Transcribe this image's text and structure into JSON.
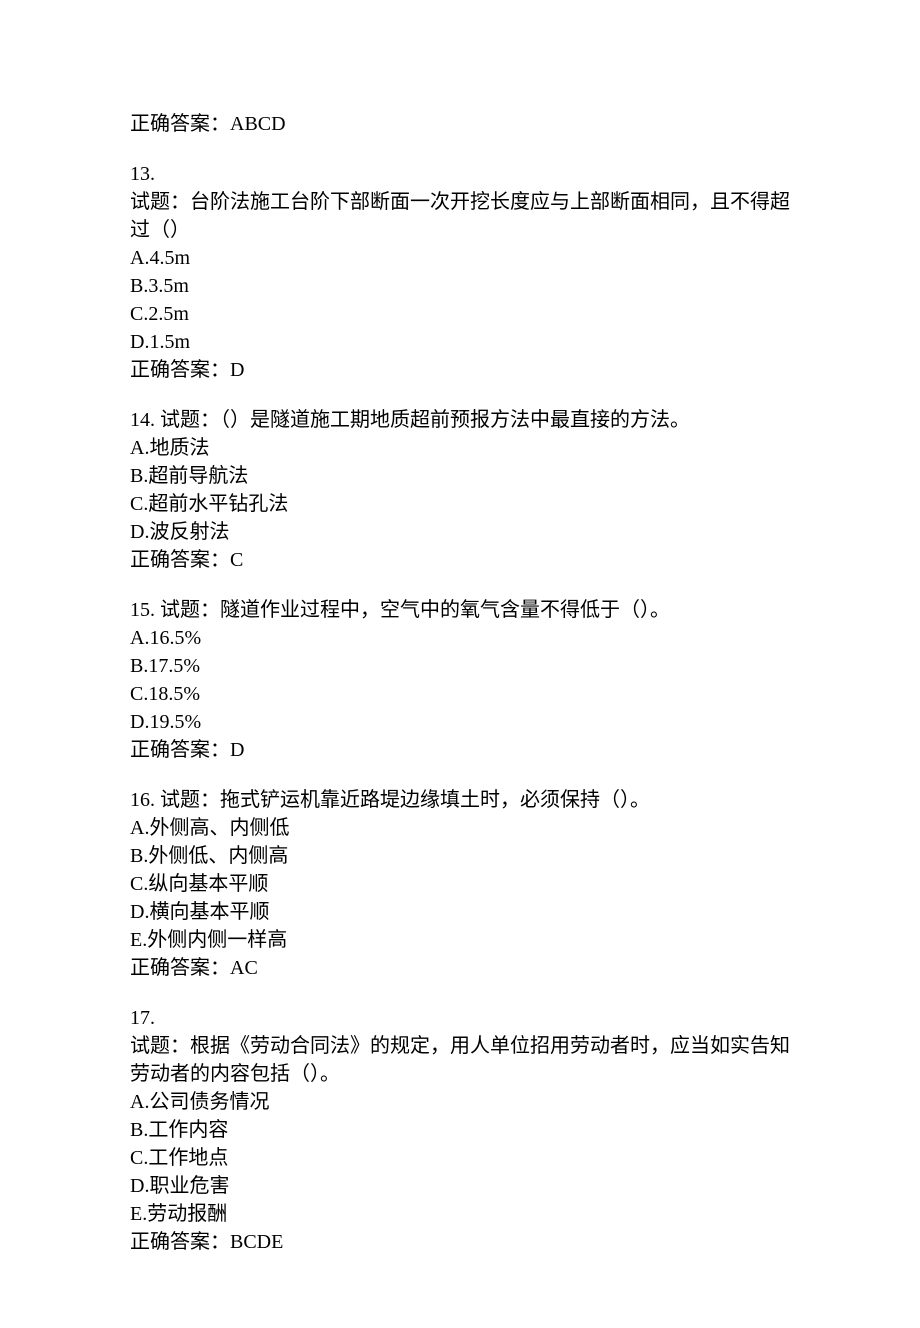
{
  "topAnswer": "正确答案：ABCD",
  "questions": [
    {
      "number": "13.",
      "prompt": "试题：台阶法施工台阶下部断面一次开挖长度应与上部断面相同，且不得超过（）",
      "options": [
        "A.4.5m",
        "B.3.5m",
        "C.2.5m",
        "D.1.5m"
      ],
      "answer": "正确答案：D"
    },
    {
      "number": "14. ",
      "inlinePrompt": "试题：（）是隧道施工期地质超前预报方法中最直接的方法。",
      "options": [
        "A.地质法",
        "B.超前导航法",
        "C.超前水平钻孔法",
        "D.波反射法"
      ],
      "answer": "正确答案：C"
    },
    {
      "number": "15. ",
      "inlinePrompt": "试题：隧道作业过程中，空气中的氧气含量不得低于（）。",
      "options": [
        "A.16.5%",
        "B.17.5%",
        "C.18.5%",
        "D.19.5%"
      ],
      "answer": "正确答案：D"
    },
    {
      "number": "16. ",
      "inlinePrompt": "试题：拖式铲运机靠近路堤边缘填土时，必须保持（）。",
      "options": [
        "A.外侧高、内侧低",
        "B.外侧低、内侧高",
        "C.纵向基本平顺",
        "D.横向基本平顺",
        "E.外侧内侧一样高"
      ],
      "answer": "正确答案：AC"
    },
    {
      "number": "17.",
      "prompt": "试题：根据《劳动合同法》的规定，用人单位招用劳动者时，应当如实告知劳动者的内容包括（）。",
      "options": [
        "A.公司债务情况",
        "B.工作内容",
        "C.工作地点",
        "D.职业危害",
        "E.劳动报酬"
      ],
      "answer": "正确答案：BCDE"
    }
  ]
}
